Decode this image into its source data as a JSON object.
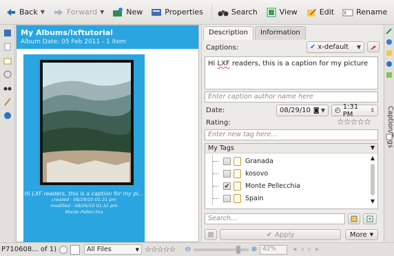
{
  "toolbar": {
    "back": "Back",
    "forward": "Forward",
    "new": "New",
    "properties": "Properties",
    "search": "Search",
    "view": "View",
    "edit": "Edit",
    "rename": "Rename"
  },
  "album": {
    "title": "My Albums/lxftutorial",
    "date_line": "Album Date: 05 Feb 2011 - 1 Item",
    "item": {
      "caption": "Hi LXF readers, this is a caption for my pi...",
      "created": "created : 08/29/10 01:31 pm",
      "modified": "modified : 08/29/10 01:31 pm",
      "location": "Monte Pellecchia"
    }
  },
  "properties": {
    "tabs": [
      "Description",
      "Information"
    ],
    "captions_label": "Captions:",
    "lang": "x-default",
    "caption_text_prefix": "Hi ",
    "caption_text_word": "LXF",
    "caption_text_suffix": " readers, this is a caption for my picture",
    "author_placeholder": "Enter caption author name here",
    "date_label": "Date:",
    "date_value": "08/29/10",
    "time_value": "1:31 PM",
    "rating_label": "Rating:",
    "rating_value": 0,
    "rating_max": 5,
    "tag_placeholder": "Enter new tag here...",
    "tags_header": "My Tags",
    "tags": [
      {
        "name": "Granada",
        "checked": false
      },
      {
        "name": "kosovo",
        "checked": false
      },
      {
        "name": "Monte Pellecchia",
        "checked": true
      },
      {
        "name": "Spain",
        "checked": false
      }
    ],
    "search_placeholder": "Search...",
    "apply": "Apply",
    "more": "More"
  },
  "rightbar": {
    "label": "Caption/Tags"
  },
  "status": {
    "count": "P710608... of 1)",
    "filter": "All Files",
    "zoom": "42%"
  },
  "colors": {
    "accent": "#2aa5e0",
    "tag_folder": "#c59a3a"
  }
}
